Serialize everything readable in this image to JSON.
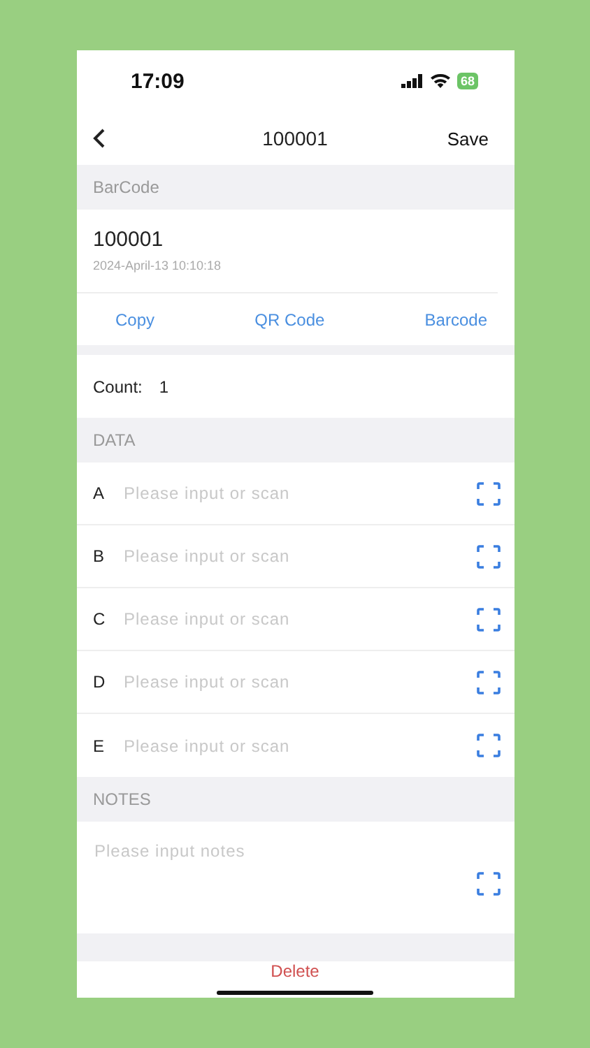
{
  "status_bar": {
    "time": "17:09",
    "battery": "68"
  },
  "nav": {
    "title": "100001",
    "action": "Save"
  },
  "barcode_section": {
    "header": "BarCode",
    "code": "100001",
    "timestamp": "2024-April-13 10:10:18",
    "actions": [
      "Copy",
      "QR Code",
      "Barcode"
    ]
  },
  "count": {
    "label": "Count:",
    "value": "1"
  },
  "data_section": {
    "header": "DATA",
    "fields": [
      {
        "label": "A",
        "placeholder": "Please input or scan"
      },
      {
        "label": "B",
        "placeholder": "Please input or scan"
      },
      {
        "label": "C",
        "placeholder": "Please input or scan"
      },
      {
        "label": "D",
        "placeholder": "Please input or scan"
      },
      {
        "label": "E",
        "placeholder": "Please input or scan"
      }
    ]
  },
  "notes_section": {
    "header": "NOTES",
    "placeholder": "Please input notes"
  },
  "delete_button": "Delete"
}
